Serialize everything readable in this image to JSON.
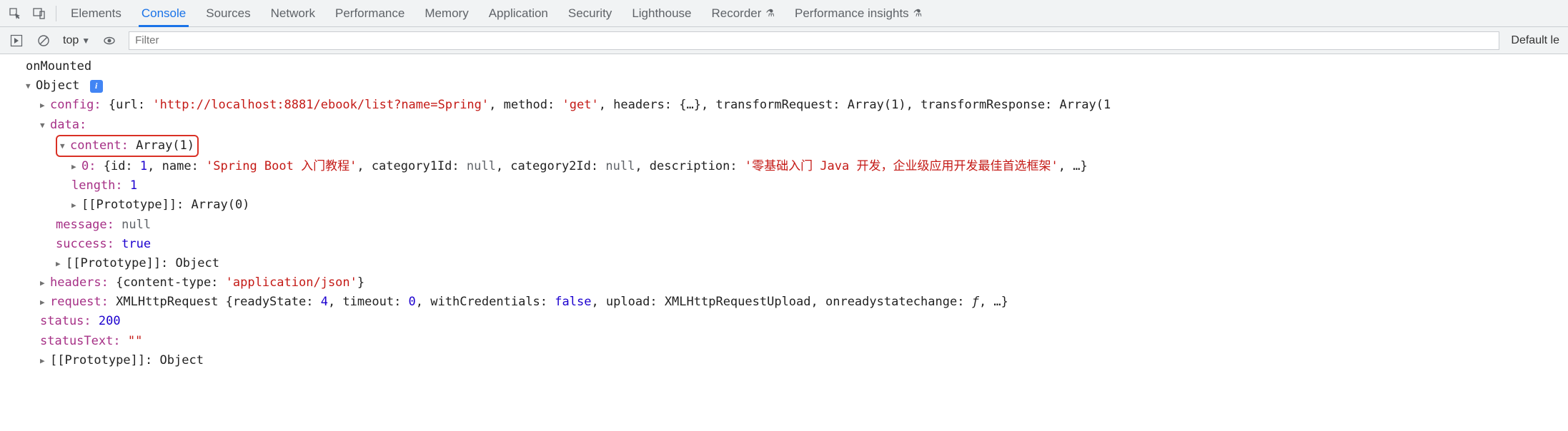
{
  "toolbar": {
    "tabs": [
      "Elements",
      "Console",
      "Sources",
      "Network",
      "Performance",
      "Memory",
      "Application",
      "Security",
      "Lighthouse",
      "Recorder",
      "Performance insights"
    ],
    "active_tab": "Console"
  },
  "subbar": {
    "context": "top",
    "filter_placeholder": "Filter",
    "levels_label": "Default le"
  },
  "console": {
    "first_log": "onMounted",
    "object_label": "Object",
    "config_key": "config:",
    "config_preview": {
      "url_key": "{url: ",
      "url_val": "'http://localhost:8881/ebook/list?name=Spring'",
      "method_key": ", method: ",
      "method_val": "'get'",
      "headers_key": ", headers: ",
      "headers_val": "{…}",
      "tr_key": ", transformRequest: ",
      "tr_val": "Array(1)",
      "tresp_key": ", transformResponse: ",
      "tresp_val": "Array(1"
    },
    "data_key": "data:",
    "content_key": "content: ",
    "content_val": "Array(1)",
    "item0_key": "0: ",
    "item0": {
      "open": "{id: ",
      "id_val": "1",
      "name_key": ", name: ",
      "name_val": "'Spring Boot 入门教程'",
      "cat1_key": ", category1Id: ",
      "cat1_val": "null",
      "cat2_key": ", category2Id: ",
      "cat2_val": "null",
      "desc_key": ", description: ",
      "desc_val": "'零基础入门 Java 开发，企业级应用开发最佳首选框架'",
      "close": ", …}"
    },
    "length_key": "length: ",
    "length_val": "1",
    "proto_arr_key": "[[Prototype]]: ",
    "proto_arr_val": "Array(0)",
    "message_key": "message: ",
    "message_val": "null",
    "success_key": "success: ",
    "success_val": "true",
    "proto_obj_key": "[[Prototype]]: ",
    "proto_obj_val": "Object",
    "headers_key": "headers: ",
    "headers_preview": {
      "open": "{content-type: ",
      "ct_val": "'application/json'",
      "close": "}"
    },
    "request_key": "request: ",
    "request_preview": {
      "open": "XMLHttpRequest {readyState: ",
      "rs_val": "4",
      "to_key": ", timeout: ",
      "to_val": "0",
      "wc_key": ", withCredentials: ",
      "wc_val": "false",
      "up_key": ", upload: ",
      "up_val": "XMLHttpRequestUpload",
      "orc_key": ", onreadystatechange: ",
      "orc_val": "ƒ",
      "close": ", …}"
    },
    "status_key": "status: ",
    "status_val": "200",
    "statustext_key": "statusText: ",
    "statustext_val": "\"\"",
    "proto_final_key": "[[Prototype]]: ",
    "proto_final_val": "Object"
  }
}
